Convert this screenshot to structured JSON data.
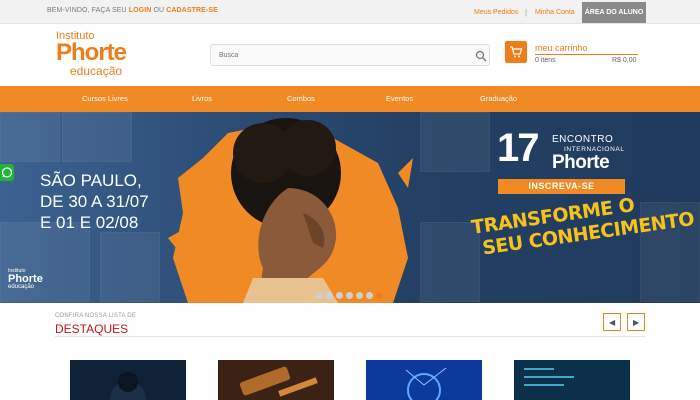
{
  "topbar": {
    "welcome_prefix": "BEM-VINDO, FAÇA SEU",
    "login": "LOGIN",
    "or": "OU",
    "signup": "CADASTRE-SE",
    "orders": "Meus Pedidos",
    "separator": "|",
    "account": "Minha Conta",
    "student_area": "ÁREA DO ALUNO"
  },
  "logo": {
    "line1": "Instituto",
    "line2": "Phorte",
    "line3": "educação"
  },
  "search": {
    "placeholder": "Busca",
    "icon": "search-icon"
  },
  "cart": {
    "title": "meu carrinho",
    "items": "0 itens",
    "total": "R$ 0,00",
    "icon": "cart-icon"
  },
  "nav": {
    "items": [
      "Cursos Livres",
      "Livros",
      "Combos",
      "Eventos",
      "Graduação"
    ]
  },
  "banner": {
    "city_line1": "SÃO PAULO,",
    "city_line2": "DE 30 A 31/07",
    "city_line3": "E 01 E 02/08",
    "event_number": "17",
    "event_line1": "ENCONTRO",
    "event_line2": "INTERNACIONAL",
    "event_line3": "Phorte",
    "cta": "INSCREVA-SE",
    "tagline_line1": "TRANSFORME O",
    "tagline_line2": "SEU CONHECIMENTO",
    "logo_line1": "Instituto",
    "logo_line2": "Phorte",
    "logo_line3": "educação",
    "slides": 7,
    "active_slide": 7
  },
  "section": {
    "subtitle": "CONFIRA NOSSA LISTA DE",
    "title": "DESTAQUES",
    "prev": "◀",
    "next": "▶"
  },
  "colors": {
    "accent": "#ef7d1a",
    "nav": "#f08a24",
    "title_red": "#c8131b",
    "banner_blue": "#2b4b74",
    "tagline_yellow": "#f6c21c"
  }
}
